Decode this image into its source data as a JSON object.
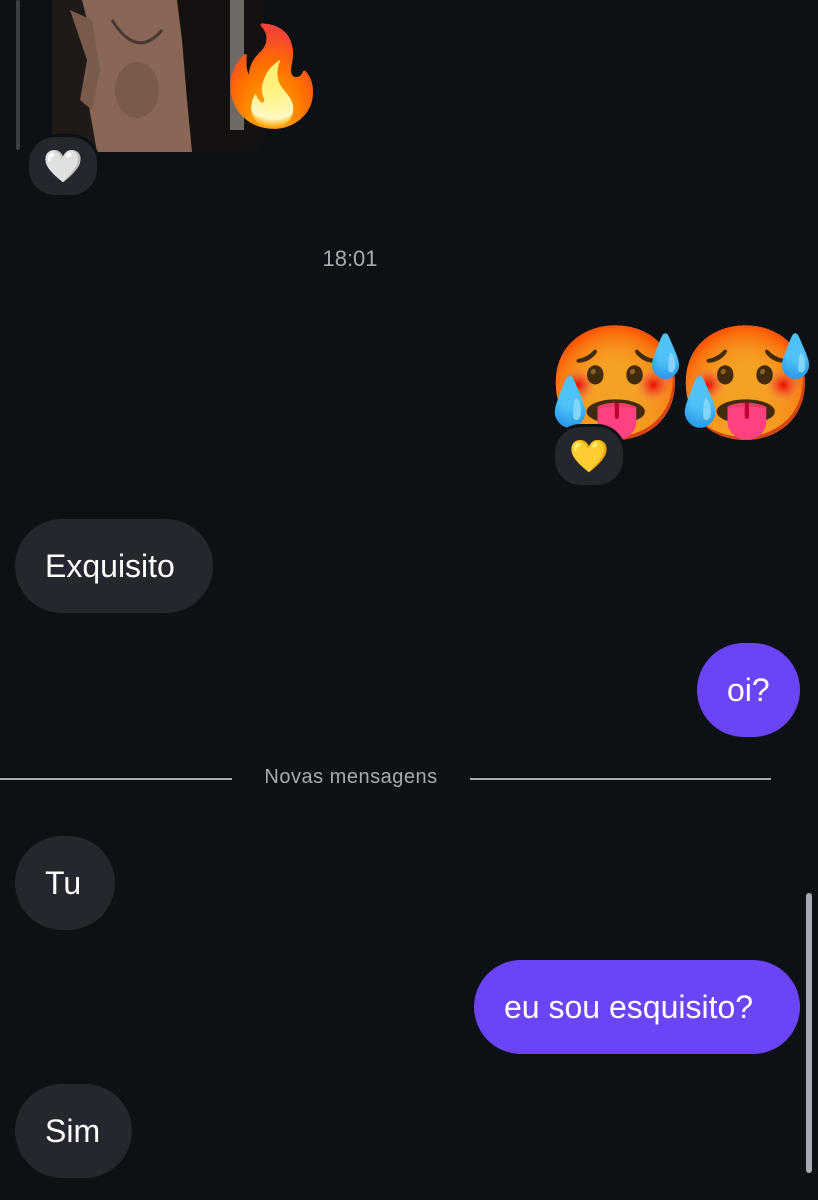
{
  "messages": {
    "photo_reaction": "🤍",
    "photo_sticker": "🔥",
    "timestamp": "18:01",
    "emoji_message_1": "🥵",
    "emoji_message_2": "🥵",
    "emoji_reaction": "💛",
    "incoming_1": "Exquisito",
    "outgoing_1": "oi?",
    "new_messages_divider": "Novas mensagens",
    "incoming_2": "Tu",
    "outgoing_2": "eu sou esquisito?",
    "incoming_3": "Sim"
  },
  "colors": {
    "background": "#0d1116",
    "incoming_bubble": "#24272d",
    "outgoing_bubble": "#6b45f5",
    "muted_text": "#a6abb3"
  }
}
